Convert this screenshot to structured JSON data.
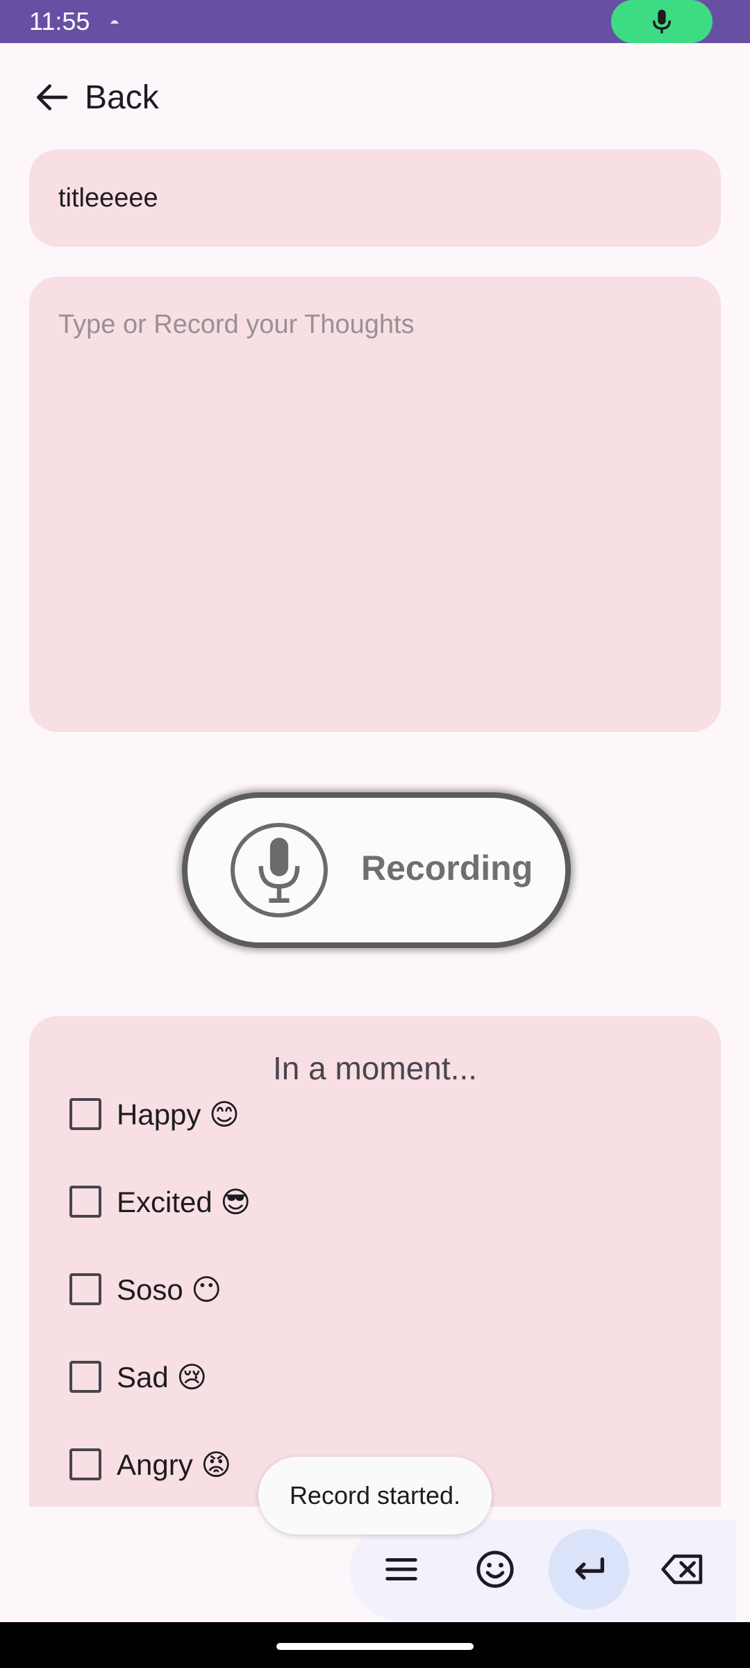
{
  "status_bar": {
    "time": "11:55",
    "mic_indicator_icon": "mic-icon",
    "background": "#6750a4",
    "mic_pill_color": "#3ddc84"
  },
  "header": {
    "back_label": "Back",
    "back_icon": "arrow-left-icon"
  },
  "editor": {
    "title_value": "titleeeee",
    "body_placeholder": "Type or Record your Thoughts",
    "field_color": "#f7dfe3"
  },
  "recorder": {
    "label": "Recording",
    "icon": "mic-icon"
  },
  "mood": {
    "title": "In a moment...",
    "items": [
      {
        "label": "Happy 😊",
        "checked": false
      },
      {
        "label": "Excited 😎",
        "checked": false
      },
      {
        "label": "Soso 😶",
        "checked": false
      },
      {
        "label": "Sad 😢",
        "checked": false
      },
      {
        "label": "Angry 😡",
        "checked": false
      }
    ]
  },
  "toast": {
    "message": "Record started."
  },
  "keyboard_toolbar": {
    "buttons": [
      "menu-icon",
      "emoji-icon",
      "enter-icon",
      "backspace-icon"
    ],
    "active_color": "#dbe3fb"
  }
}
